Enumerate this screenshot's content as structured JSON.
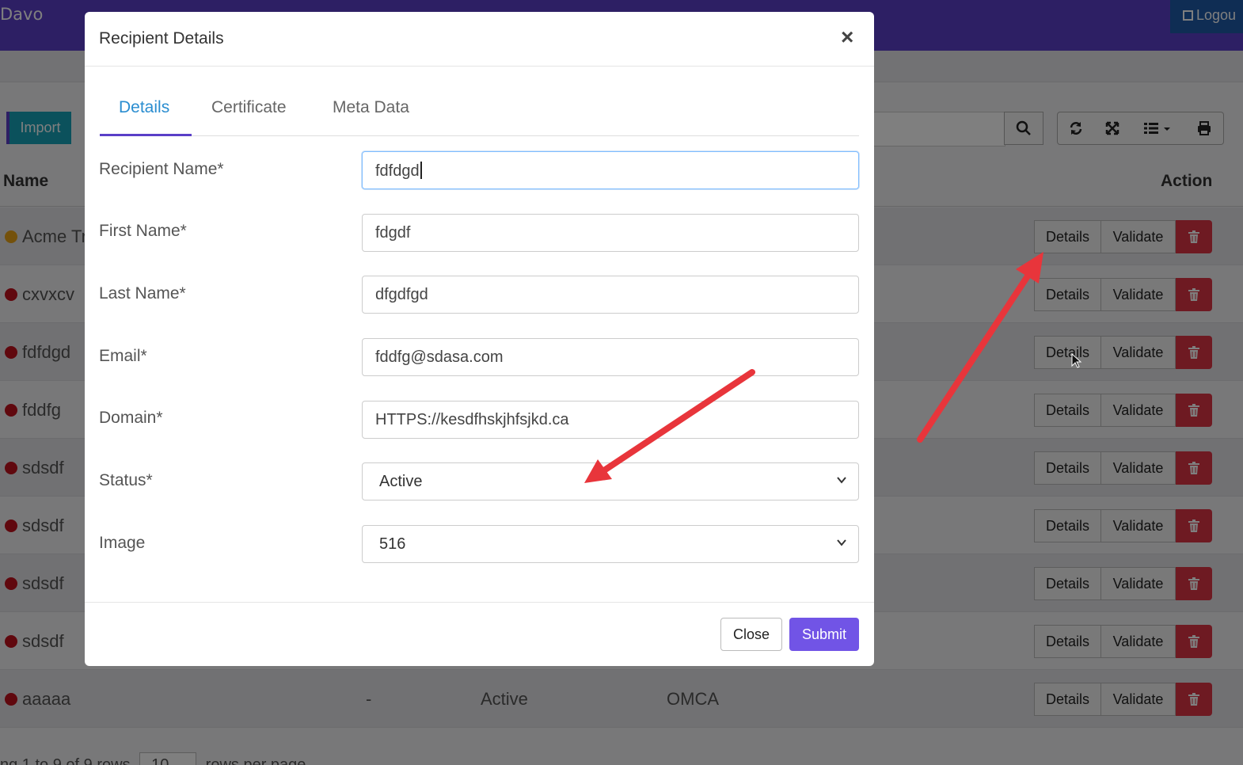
{
  "app": {
    "brand": "Davo",
    "logout_label": "Logou"
  },
  "toolbar": {
    "import_label": "Import"
  },
  "table": {
    "col_name": "Name",
    "col_action": "Action",
    "details_label": "Details",
    "validate_label": "Validate",
    "rows": [
      {
        "name": "Acme Tr",
        "status_color": "#e8a317"
      },
      {
        "name": "cxvxcv",
        "status_color": "#c0101c"
      },
      {
        "name": "fdfdgd",
        "status_color": "#c0101c"
      },
      {
        "name": "fddfg",
        "status_color": "#c0101c"
      },
      {
        "name": "sdsdf",
        "status_color": "#c0101c"
      },
      {
        "name": "sdsdf",
        "status_color": "#c0101c"
      },
      {
        "name": "sdsdf",
        "status_color": "#c0101c"
      },
      {
        "name": "sdsdf",
        "status_color": "#c0101c"
      },
      {
        "name": "aaaaa",
        "col2": "-",
        "col3": "Active",
        "col4": "OMCA",
        "status_color": "#c0101c"
      }
    ],
    "footer_prefix": "ng 1 to 9 of 9 rows",
    "per_page": "10",
    "footer_suffix": "rows per page"
  },
  "modal": {
    "title": "Recipient Details",
    "close_icon": "×",
    "tabs": [
      {
        "label": "Details",
        "active": true
      },
      {
        "label": "Certificate",
        "active": false
      },
      {
        "label": "Meta Data",
        "active": false
      }
    ],
    "fields": [
      {
        "label": "Recipient Name*",
        "value": "fdfdgd"
      },
      {
        "label": "First Name*",
        "value": "fdgdf"
      },
      {
        "label": "Last Name*",
        "value": "dfgdfgd"
      },
      {
        "label": "Email*",
        "value": "fddfg@sdasa.com"
      },
      {
        "label": "Domain*",
        "value": "HTTPS://kesdfhskjhfsjkd.ca"
      },
      {
        "label": "Status*",
        "value": "Active"
      },
      {
        "label": "Image",
        "value": "516"
      }
    ],
    "close_label": "Close",
    "submit_label": "Submit"
  },
  "colors": {
    "brand": "#5a3fc8",
    "primary": "#7154e6",
    "danger": "#dc3545",
    "info": "#17a2b8",
    "annotation": "#e8353b"
  }
}
